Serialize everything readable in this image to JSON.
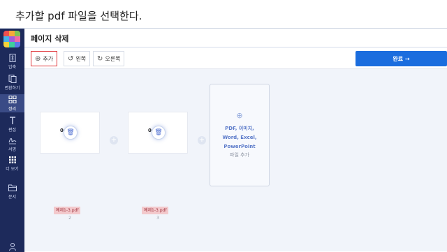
{
  "instruction": "추가할 pdf 파일을  선택한다.",
  "sidebar": {
    "logo_colors": [
      "#f0504f",
      "#f7a93b",
      "#7ec356",
      "#47b3e9",
      "#a25ddc",
      "#f06aa5",
      "#f7d33b",
      "#3fcf9b",
      "#5d78e6"
    ],
    "items": [
      {
        "label": "압축",
        "icon": "compress-icon"
      },
      {
        "label": "변환하기",
        "icon": "convert-icon"
      },
      {
        "label": "정리",
        "icon": "grid-icon",
        "active": true
      },
      {
        "label": "편집",
        "icon": "text-edit-icon"
      },
      {
        "label": "서명",
        "icon": "signature-icon"
      },
      {
        "label": "더 보기",
        "icon": "more-grid-icon"
      },
      {
        "label": "문서",
        "icon": "folder-icon"
      }
    ]
  },
  "header": {
    "title": "페이지 삭제"
  },
  "toolbar": {
    "add_label": "추가",
    "rotate_left_label": "왼쪽",
    "rotate_right_label": "오른쪽",
    "done_label": "완료 →"
  },
  "pages": [
    {
      "zero": "0",
      "file": "예제1-3.pdf",
      "number": "2"
    },
    {
      "zero": "0",
      "file": "예제1-3.pdf",
      "number": "3"
    }
  ],
  "add_zone": {
    "plus": "⊕",
    "types_line1": "PDF, 이미지,",
    "types_line2": "Word, Excel,",
    "types_line3": "PowerPoint",
    "sub": "파일 추가"
  }
}
